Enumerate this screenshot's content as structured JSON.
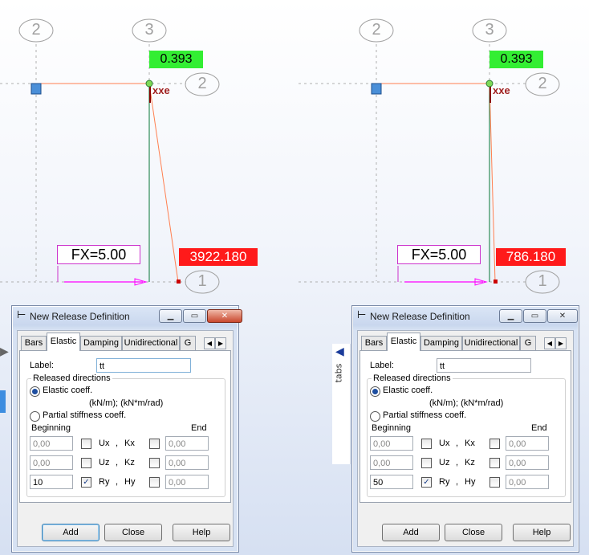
{
  "left_view": {
    "axis_labels": [
      "2",
      "3",
      "2",
      "1"
    ],
    "top_value": "0.393",
    "bottom_value": "3922.180",
    "release_label": "xxe",
    "force_label": "FX=5.00"
  },
  "right_view": {
    "axis_labels": [
      "2",
      "3",
      "2",
      "1"
    ],
    "top_value": "0.393",
    "bottom_value": "786.180",
    "release_label": "xxe",
    "force_label": "FX=5.00"
  },
  "side_tab": {
    "label": "tabs"
  },
  "dialogs": [
    {
      "title": "New Release Definition",
      "tabs": [
        "Bars",
        "Elastic",
        "Damping",
        "Unidirectional",
        "G"
      ],
      "active_tab": "Elastic",
      "label_caption": "Label:",
      "label_value": "tt",
      "group_title": "Released directions",
      "radio_elastic": "Elastic coeff.",
      "units": "(kN/m);  (kN*m/rad)",
      "radio_partial": "Partial stiffness coeff.",
      "beginning": "Beginning",
      "end": "End",
      "rows": [
        {
          "begin": "0,00",
          "dir": "Ux",
          "sep": ",",
          "coef": "Kx",
          "end": "0,00",
          "checked_begin": false
        },
        {
          "begin": "0,00",
          "dir": "Uz",
          "sep": ",",
          "coef": "Kz",
          "end": "0,00",
          "checked_begin": false
        },
        {
          "begin": "10",
          "dir": "Ry",
          "sep": ",",
          "coef": "Hy",
          "end": "0,00",
          "checked_begin": true
        }
      ],
      "buttons": {
        "add": "Add",
        "close": "Close",
        "help": "Help"
      }
    },
    {
      "title": "New Release Definition",
      "tabs": [
        "Bars",
        "Elastic",
        "Damping",
        "Unidirectional",
        "G"
      ],
      "active_tab": "Elastic",
      "label_caption": "Label:",
      "label_value": "tt",
      "group_title": "Released directions",
      "radio_elastic": "Elastic coeff.",
      "units": "(kN/m);  (kN*m/rad)",
      "radio_partial": "Partial stiffness coeff.",
      "beginning": "Beginning",
      "end": "End",
      "rows": [
        {
          "begin": "0,00",
          "dir": "Ux",
          "sep": ",",
          "coef": "Kx",
          "end": "0,00",
          "checked_begin": false
        },
        {
          "begin": "0,00",
          "dir": "Uz",
          "sep": ",",
          "coef": "Kz",
          "end": "0,00",
          "checked_begin": false
        },
        {
          "begin": "50",
          "dir": "Ry",
          "sep": ",",
          "coef": "Hy",
          "end": "0,00",
          "checked_begin": true
        }
      ],
      "buttons": {
        "add": "Add",
        "close": "Close",
        "help": "Help"
      }
    }
  ]
}
